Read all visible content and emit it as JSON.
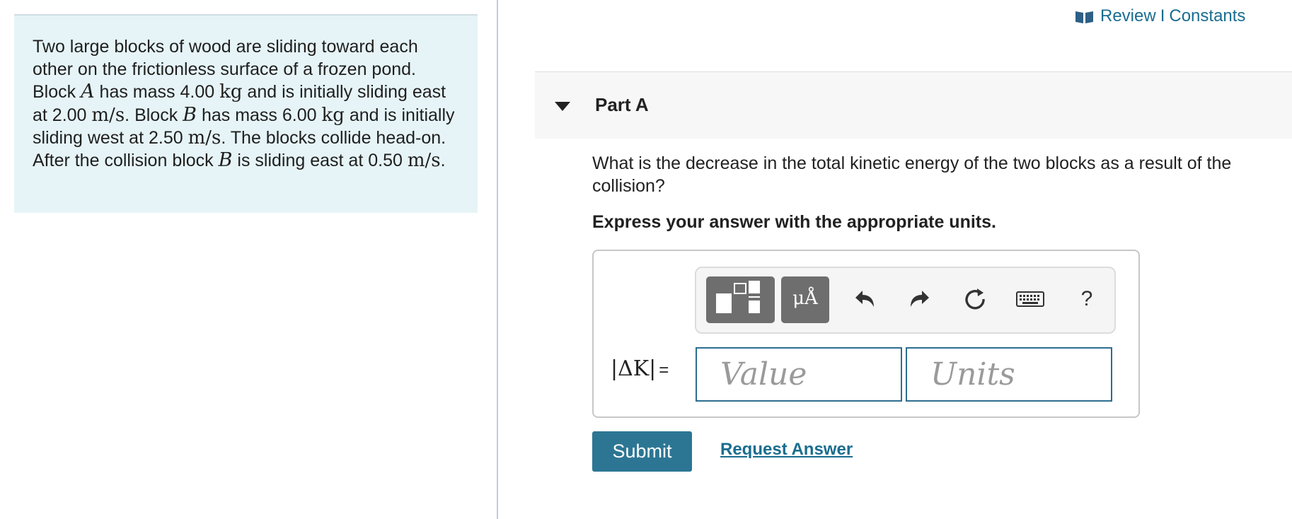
{
  "problem": {
    "t1": "Two large blocks of wood are sliding toward each other on the frictionless surface of a frozen pond. Block ",
    "blockA": "A",
    "t2": " has mass 4.00 ",
    "kg1": "kg",
    "t3": " and is initially sliding east at 2.00 ",
    "ms1": "m/s",
    "t4": ". Block ",
    "blockB": "B",
    "t5": " has mass 6.00 ",
    "kg2": "kg",
    "t6": " and is initially sliding west at 2.50 ",
    "ms2": "m/s",
    "t7": ". The blocks collide head-on. After the collision block ",
    "blockB2": "B",
    "t8": " is sliding east at 0.50 ",
    "ms3": "m/s",
    "t9": "."
  },
  "header_links": {
    "review": "Review",
    "separator": "I",
    "constants": "Constants"
  },
  "part": {
    "title": "Part A"
  },
  "question": "What is the decrease in the total kinetic energy of the two blocks as a result of the collision?",
  "instruction": "Express your answer with the appropriate units.",
  "toolbar": {
    "units_label": "μÅ",
    "help_label": "?",
    "icons": [
      "templates-icon",
      "units-icon",
      "undo-icon",
      "redo-icon",
      "reset-icon",
      "keyboard-icon",
      "help-icon"
    ]
  },
  "answer": {
    "label": "|ΔK|",
    "equals": "=",
    "value_placeholder": "Value",
    "units_placeholder": "Units"
  },
  "buttons": {
    "submit": "Submit",
    "request_answer": "Request Answer"
  },
  "colors": {
    "accent": "#2c7694",
    "link": "#1a6d8f",
    "panel_bg": "#e6f4f7"
  }
}
